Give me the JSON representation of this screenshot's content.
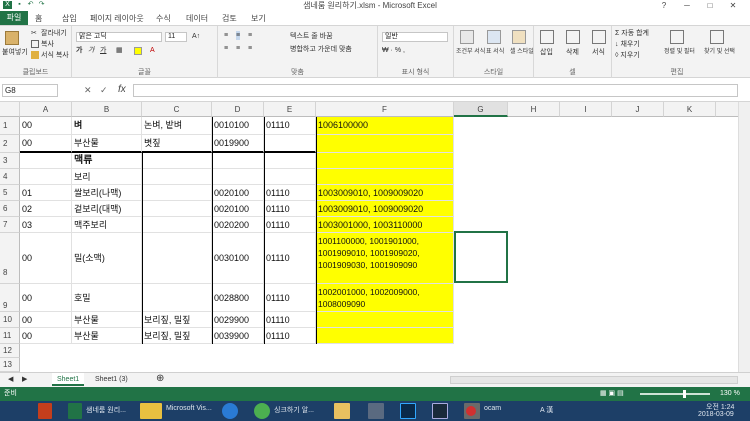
{
  "window": {
    "title": "샘네룸 원리하기.xlsm - Microsoft Excel",
    "min": "─",
    "max": "□",
    "close": "✕",
    "help": "?"
  },
  "tabs": {
    "file": "파일",
    "items": [
      "홈",
      "삽입",
      "페이지 레이아웃",
      "수식",
      "데이터",
      "검토",
      "보기"
    ]
  },
  "ribbon": {
    "clipboard": {
      "paste": "붙여넣기",
      "cut": "잘라내기",
      "copy": "복사",
      "format_painter": "서식 복사",
      "label": "클립보드"
    },
    "font": {
      "name": "맑은 고딕",
      "size": "11",
      "bold": "가",
      "italic": "가",
      "underline": "가",
      "label": "글꼴"
    },
    "align": {
      "wrap": "텍스트 줄 바꿈",
      "merge": "병합하고 가운데 맞춤",
      "label": "맞춤"
    },
    "number": {
      "format": "일반",
      "label": "표시 형식"
    },
    "styles": {
      "cond": "조건부 서식",
      "table": "표 서식",
      "cell": "셀 스타일",
      "label": "스타일"
    },
    "cells": {
      "insert": "삽입",
      "delete": "삭제",
      "format": "서식",
      "label": "셀"
    },
    "editing": {
      "autosum": "자동 합계",
      "fill": "채우기",
      "clear": "지우기",
      "sort": "정렬 및 필터",
      "find": "찾기 및 선택",
      "label": "편집"
    }
  },
  "formula_bar": {
    "name_box": "G8",
    "fx": "fx",
    "value": ""
  },
  "columns": [
    "A",
    "B",
    "C",
    "D",
    "E",
    "F",
    "G",
    "H",
    "I",
    "J",
    "K"
  ],
  "rows": [
    {
      "num": "1",
      "a": "00",
      "b": "벼",
      "c": "논벼, 밭벼",
      "d": "0010100",
      "e": "01110",
      "f": "1006100000"
    },
    {
      "num": "2",
      "a": "00",
      "b": "부산물",
      "c": "볏짚",
      "d": "0019900",
      "e": "",
      "f": ""
    },
    {
      "num": "3",
      "a": "",
      "b": "맥류",
      "c": "",
      "d": "",
      "e": "",
      "f": ""
    },
    {
      "num": "4",
      "a": "",
      "b": "보리",
      "c": "",
      "d": "",
      "e": "",
      "f": ""
    },
    {
      "num": "5",
      "a": "01",
      "b": "쌀보리(나맥)",
      "c": "",
      "d": "0020100",
      "e": "01110",
      "f": "1003009010, 1009009020"
    },
    {
      "num": "6",
      "a": "02",
      "b": "겉보리(대맥)",
      "c": "",
      "d": "0020100",
      "e": "01110",
      "f": "1003009010, 1009009020"
    },
    {
      "num": "7",
      "a": "03",
      "b": "맥주보리",
      "c": "",
      "d": "0020200",
      "e": "01110",
      "f": "1003001000, 1003110000"
    },
    {
      "num": "8",
      "a": "00",
      "b": "밀(소맥)",
      "c": "",
      "d": "0030100",
      "e": "01110",
      "f": "1001100000, 1001901000, 1001909010, 1001909020, 1001909030, 1001909090"
    },
    {
      "num": "9",
      "a": "00",
      "b": "호밀",
      "c": "",
      "d": "0028800",
      "e": "01110",
      "f": "1002001000, 1002009000, 1008009090"
    },
    {
      "num": "10",
      "a": "00",
      "b": "부산물",
      "c": "보리짚, 밀짚",
      "d": "0029900",
      "e": "01110",
      "f": ""
    },
    {
      "num": "11",
      "a": "00",
      "b": "부산물",
      "c": "보리짚, 밀짚",
      "d": "0039900",
      "e": "01110",
      "f": ""
    },
    {
      "num": "12",
      "a": "",
      "b": "",
      "c": "",
      "d": "",
      "e": "",
      "f": ""
    },
    {
      "num": "13",
      "a": "",
      "b": "",
      "c": "",
      "d": "",
      "e": "",
      "f": ""
    }
  ],
  "sheets": [
    "Sheet1",
    "Sheet1 (3)"
  ],
  "add_sheet": "⊕",
  "status": {
    "ready": "준비",
    "zoom": "130 %"
  },
  "taskbar": {
    "items": [
      "샘네룸 원리...",
      "Microsoft Vis...",
      "",
      "싱크하기 알...",
      "",
      "",
      "",
      "",
      "ocam"
    ],
    "lang": "A 漢",
    "time": "오전 1:24",
    "date": "2018-03-09"
  }
}
